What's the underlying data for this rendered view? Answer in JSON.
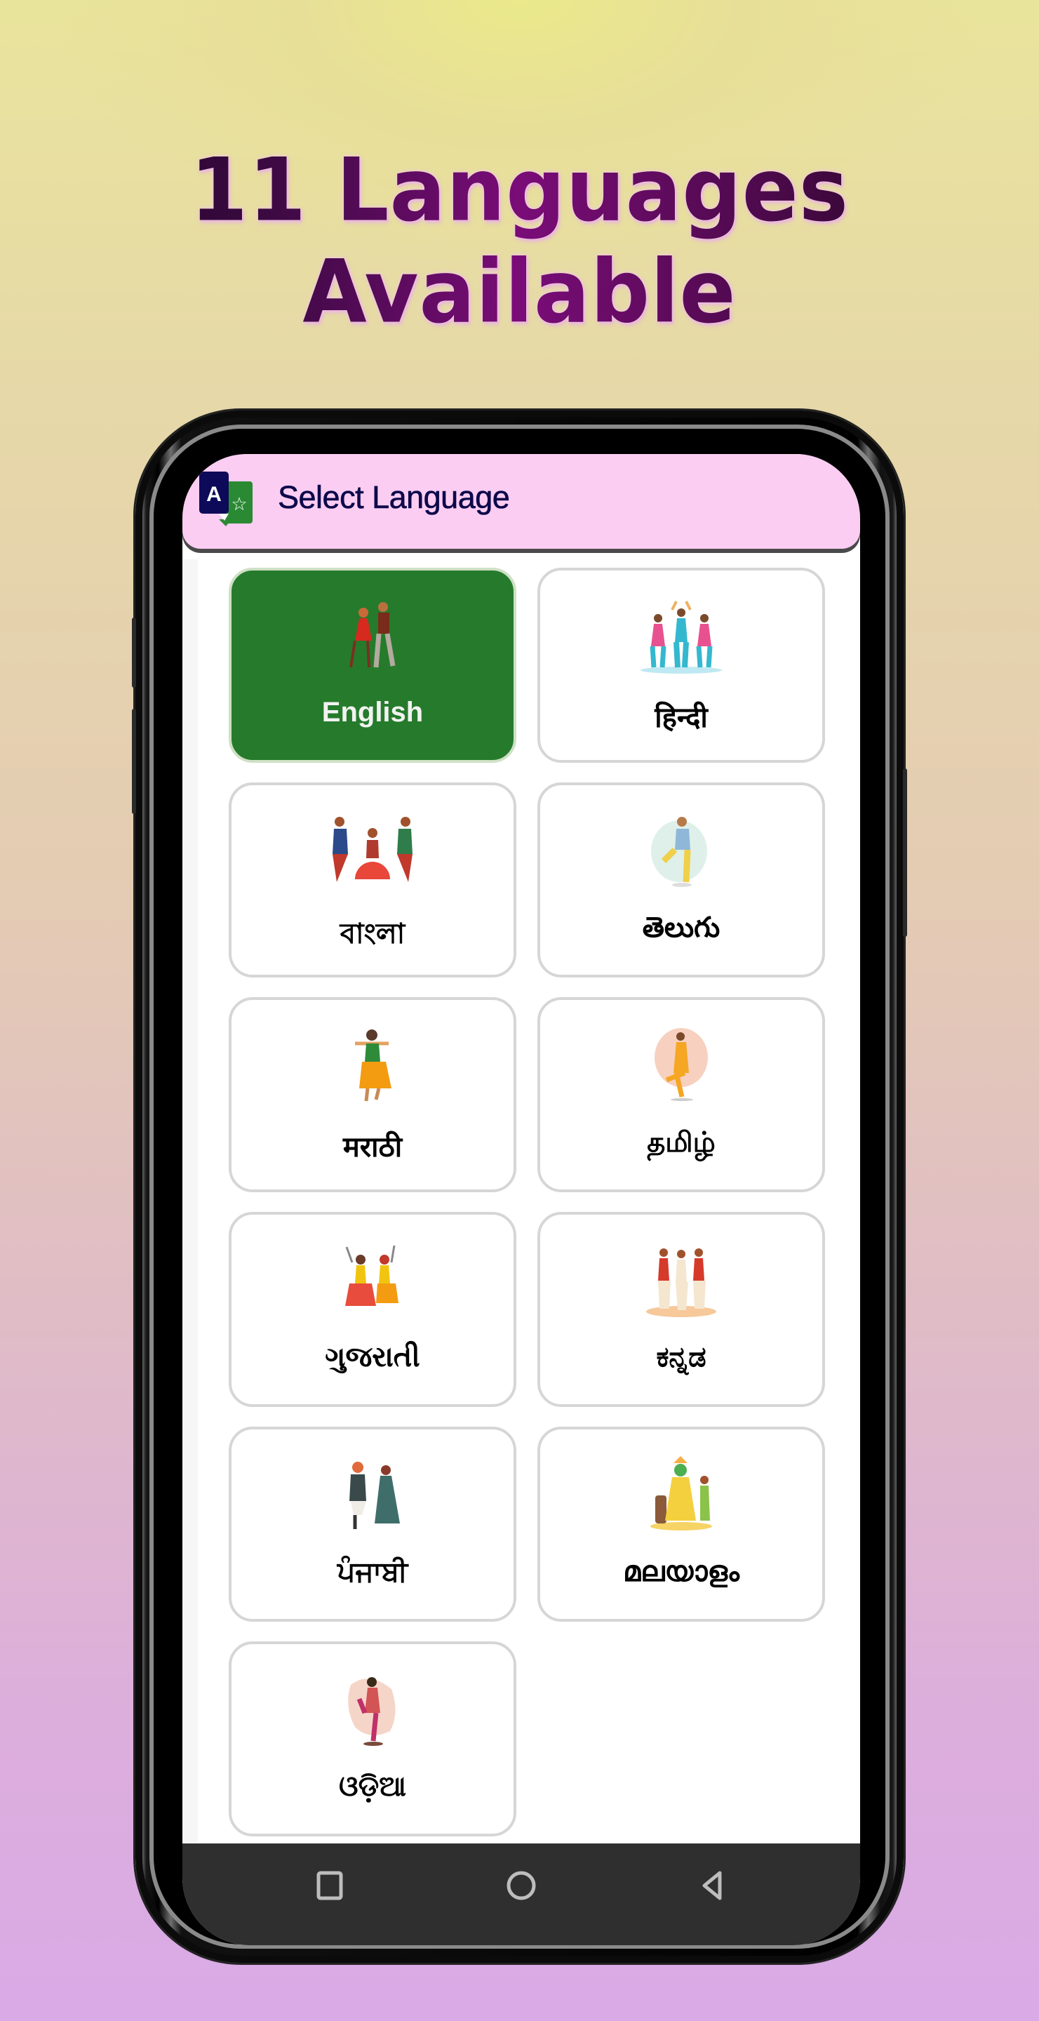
{
  "headline": "11 Languages Available",
  "appbar": {
    "icon": "translate-icon",
    "title": "Select Language",
    "background": "#fccdf2",
    "title_color": "#0d0a4a"
  },
  "colors": {
    "selected_card": "#257b2b",
    "card_border": "#d6d6d6",
    "navbar": "#2f2f2f"
  },
  "languages": [
    {
      "label": "English",
      "illustration": "couple-dancing-illustration",
      "selected": true
    },
    {
      "label": "हिन्दी",
      "illustration": "group-dancers-illustration",
      "selected": false
    },
    {
      "label": "বাংলা",
      "illustration": "classical-dancers-illustration",
      "selected": false
    },
    {
      "label": "తెలుగు",
      "illustration": "kuchipudi-dancer-illustration",
      "selected": false
    },
    {
      "label": "मराठी",
      "illustration": "lavani-dancer-illustration",
      "selected": false
    },
    {
      "label": "தமிழ்",
      "illustration": "bharatanatyam-dancer-illustration",
      "selected": false
    },
    {
      "label": "ગુજરાતી",
      "illustration": "garba-dancers-illustration",
      "selected": false
    },
    {
      "label": "ಕನ್ನಡ",
      "illustration": "folk-dancers-illustration",
      "selected": false
    },
    {
      "label": "ਪੰਜਾਬੀ",
      "illustration": "bhangra-dancers-illustration",
      "selected": false
    },
    {
      "label": "മലയാളം",
      "illustration": "kathakali-illustration",
      "selected": false
    },
    {
      "label": "ଓଡ଼ିଆ",
      "illustration": "odissi-dancer-illustration",
      "selected": false
    }
  ],
  "navbar": {
    "buttons": [
      "recents-icon",
      "home-icon",
      "back-icon"
    ]
  }
}
